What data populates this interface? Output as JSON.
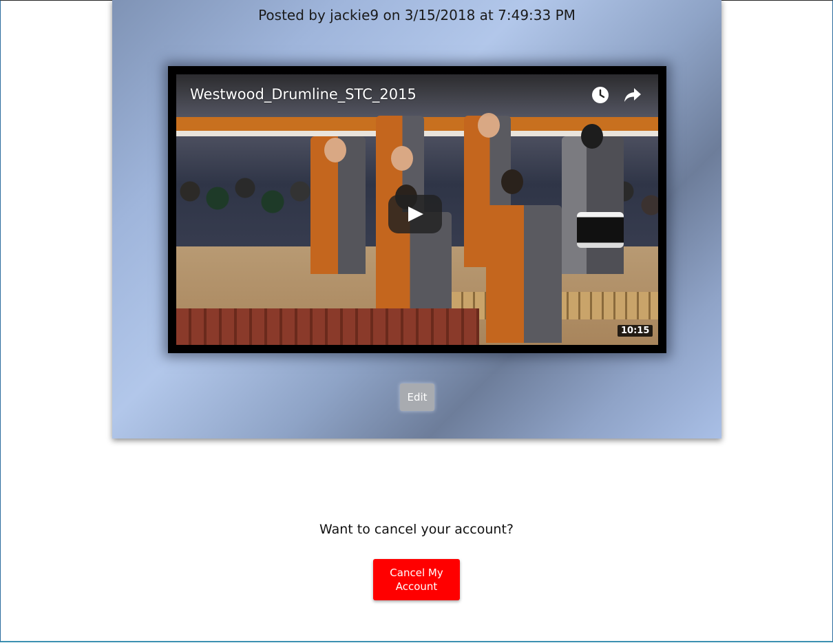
{
  "post": {
    "meta": "Posted by jackie9 on 3/15/2018 at 7:49:33 PM",
    "edit_label": "Edit"
  },
  "video": {
    "title": "Westwood_Drumline_STC_2015",
    "duration": "10:15",
    "icons": {
      "watch_later": "clock-icon",
      "share": "share-arrow-icon",
      "play": "play-icon"
    }
  },
  "account": {
    "cancel_prompt": "Want to cancel your account?",
    "cancel_label": "Cancel My Account"
  },
  "colors": {
    "cancel_button": "#ff0000",
    "edit_button": "#a8abb0",
    "card_gradient_light": "#b2c7ea",
    "card_gradient_dark": "#6d7d9a"
  }
}
